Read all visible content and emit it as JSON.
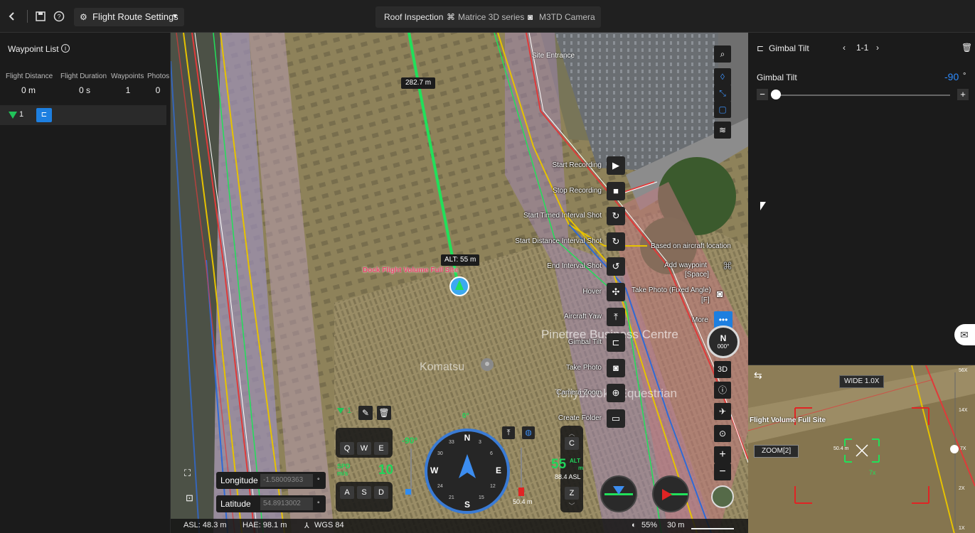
{
  "topbar": {
    "back_icon": "chevron-left-icon",
    "save_icon": "save-icon",
    "help_icon": "question-icon",
    "route_settings_label": "Flight Route Settings",
    "mission_name": "Roof Inspection",
    "aircraft": "Matrice 3D series",
    "camera": "M3TD Camera"
  },
  "waypoint_list": {
    "title": "Waypoint List",
    "stats": [
      {
        "label": "Flight Distance",
        "value": "0 m"
      },
      {
        "label": "Flight Duration",
        "value": "0 s"
      },
      {
        "label": "Waypoints",
        "value": "1"
      },
      {
        "label": "Photos",
        "value": "0"
      }
    ],
    "items": [
      {
        "number": "1"
      }
    ]
  },
  "map": {
    "distance_label": "282.7 m",
    "altitude_label": "ALT: 55 m",
    "site_entrance": "Site Entrance",
    "business_centre": "Pinetree Business Centre",
    "komatsu": "Komatsu",
    "equestrian": "Tollybrooke Equestrian",
    "volume_label": "Dock Flight Volume Full Site",
    "actions": [
      {
        "label": "Start Recording",
        "icon": "video-start-icon"
      },
      {
        "label": "Stop Recording",
        "icon": "video-stop-icon"
      },
      {
        "label": "Start Timed Interval Shot",
        "icon": "timer-icon"
      },
      {
        "label": "Start Distance Interval Shot",
        "icon": "distance-interval-icon"
      },
      {
        "label": "End Interval Shot",
        "icon": "end-interval-icon"
      },
      {
        "label": "Hover",
        "icon": "hover-icon"
      },
      {
        "label": "Aircraft Yaw",
        "icon": "yaw-icon"
      },
      {
        "label": "Gimbal Tilt",
        "icon": "gimbal-icon"
      },
      {
        "label": "Take Photo",
        "icon": "camera-icon"
      },
      {
        "label": "Camera Zoom",
        "icon": "zoom-icon"
      },
      {
        "label": "Create Folder",
        "icon": "folder-icon"
      }
    ],
    "context_menu": {
      "based_on_aircraft": "Based on aircraft location",
      "add_waypoint": "Add waypoint",
      "add_waypoint_key": "[Space]",
      "take_photo_fixed": "Take Photo (Fixed Angle)",
      "take_photo_key": "[F]",
      "more": "More"
    },
    "right_tools": {
      "three_d": "3D",
      "compass_n": "N",
      "compass_deg": "000°"
    },
    "hud": {
      "waypoint_num": "1",
      "keys_top": [
        "Q",
        "W",
        "E"
      ],
      "keys_bottom": [
        "A",
        "S",
        "D"
      ],
      "spd_label": "SPD",
      "spd_unit": "m/s",
      "speed": "10",
      "gimbal_angle": "-90°",
      "heading_top": "0°",
      "compass": [
        "N",
        "E",
        "S",
        "W",
        "3",
        "6",
        "12",
        "15",
        "21",
        "24",
        "30",
        "33"
      ],
      "alt_value": "55",
      "alt_label": "ALT",
      "alt_unit": "m",
      "asl_value": "88.4 ASL",
      "key_c": "C",
      "key_z": "Z",
      "gimbal_distance": "50.4 m"
    },
    "coords": {
      "longitude_label": "Longitude",
      "longitude_value": "-1.58009363",
      "latitude_label": "Latitude",
      "latitude_value": "54.8913002",
      "unit": "°"
    },
    "status": {
      "asl": "ASL: 48.3 m",
      "hae": "HAE: 98.1 m",
      "datum": "WGS 84",
      "battery": "55%",
      "scale": "30 m"
    }
  },
  "gimbal_panel": {
    "title": "Gimbal Tilt",
    "index": "1-1",
    "label": "Gimbal Tilt",
    "value": "-90",
    "unit": "°",
    "slider_level": 0.0
  },
  "camera_view": {
    "lens": "WIDE 1.0X",
    "zoom_label": "ZOOM[2]",
    "distance": "50.4 m",
    "zoom_factor": "7x",
    "scale_top": "56X",
    "scale_14": "14X",
    "scale_7": "7X",
    "scale_2": "2X",
    "scale_1": "1X",
    "volume_label": "Flight Volume Full Site"
  },
  "colors": {
    "accent": "#1d7fe0",
    "route_green": "#21e05a",
    "hud_green": "#21d35a",
    "warning_red": "#e02424",
    "gimbal_value_blue": "#2e8cff"
  }
}
